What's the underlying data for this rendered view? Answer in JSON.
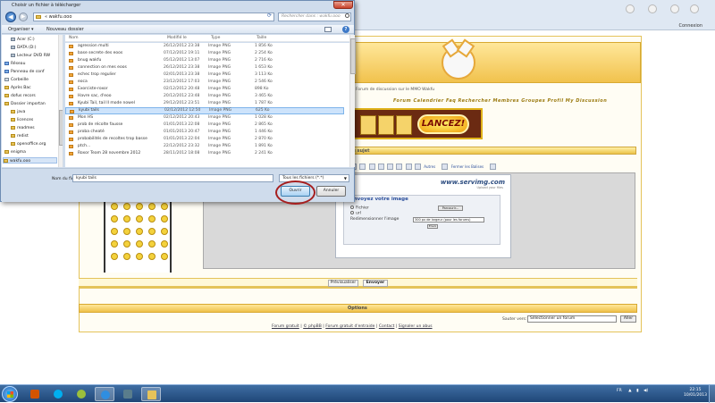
{
  "browser": {
    "login_label": "Connexion"
  },
  "forum": {
    "tagline": "Forum de discussion sur le MMO Wakfu",
    "nav": "Forum  Calendrier  Faq  Rechercher  Membres  Groupes  Profil  My  Discussion",
    "ad_button": "LANCEZ!",
    "post_header": "Nouveau sujet",
    "toolbar_texts": [
      "Autres",
      "Fermer les Balises"
    ],
    "upload": {
      "logo": "www.servimg.com",
      "slogan": "Upload your files",
      "title": "Envoyez votre image",
      "file_label": "Fichier",
      "url_label": "url",
      "browse_label": "Parcourir...",
      "resize_label": "Redimensionner l'image",
      "resize_value": "300 px de largeur (pour les forums)",
      "send_label": "Envoi"
    },
    "preview_label": "Prévisualiser",
    "send_label": "Envoyer",
    "options_label": "Options",
    "jump_label": "Sauter vers:",
    "jump_value": "Sélectionner un forum",
    "go_label": "Aller",
    "footer_links": [
      "Forum gratuit",
      "© phpBB",
      "Forum gratuit d'entraide",
      "Contact",
      "Signaler un abus"
    ]
  },
  "dialog": {
    "title": "Choisir un fichier à télécharger",
    "address": "« wakfu.ooo",
    "search_placeholder": "Rechercher dans : wakfu.ooo",
    "organiser_label": "Organiser ▾",
    "new_folder_label": "Nouveau dossier",
    "nav_items": [
      "Acer (C:)",
      "DATA (D:)",
      "Lecteur DVD RW",
      "Réseau",
      "Panneau de conf",
      "Corbeille",
      "Après Bac",
      "dofus recors",
      "Dossier importan",
      "java",
      "licences",
      "readmes",
      "redist",
      "openoffice.org",
      "enigma",
      "wakfu.ooo"
    ],
    "columns": {
      "name": "Nom",
      "date": "Modifié le",
      "type": "Type",
      "size": "Taille"
    },
    "files": [
      {
        "name": "agression multi",
        "date": "26/12/2012 23:38",
        "type": "Image PNG",
        "size": "1 856 Ko"
      },
      {
        "name": "base secrete des eoos",
        "date": "07/12/2012 19:11",
        "type": "Image PNG",
        "size": "2 254 Ko"
      },
      {
        "name": "bnug wakfu",
        "date": "05/12/2012 13:07",
        "type": "Image PNG",
        "size": "2 716 Ko"
      },
      {
        "name": "connection on mes eoos",
        "date": "26/12/2012 23:38",
        "type": "Image PNG",
        "size": "1 653 Ko"
      },
      {
        "name": "echec trop regulier",
        "date": "02/01/2013 23:38",
        "type": "Image PNG",
        "size": "3 113 Ko"
      },
      {
        "name": "eoca",
        "date": "23/12/2012 17:03",
        "type": "Image PNG",
        "size": "2 546 Ko"
      },
      {
        "name": "Exorciste-roxor",
        "date": "02/12/2012 20:48",
        "type": "Image PNG",
        "size": "898 Ko"
      },
      {
        "name": "Havre sac, d'eoo",
        "date": "20/12/2012 23:48",
        "type": "Image PNG",
        "size": "3 465 Ko"
      },
      {
        "name": "Kyubi Tail, tail II mode nowel",
        "date": "29/12/2012 23:51",
        "type": "Image PNG",
        "size": "1 787 Ko"
      },
      {
        "name": "kyubi tails",
        "date": "02/12/2012 12:50",
        "type": "Image PNG",
        "size": "625 Ko"
      },
      {
        "name": "Mon HS",
        "date": "02/12/2012 20:43",
        "type": "Image PNG",
        "size": "1 028 Ko"
      },
      {
        "name": "prob de récolte fausse",
        "date": "01/01/2013 22:08",
        "type": "Image PNG",
        "size": "2 865 Ko"
      },
      {
        "name": "proba cheaté",
        "date": "01/01/2013 20:47",
        "type": "Image PNG",
        "size": "1 446 Ko"
      },
      {
        "name": "probabilités de recoltes trop basse",
        "date": "01/01/2013 22:04",
        "type": "Image PNG",
        "size": "2 870 Ko"
      },
      {
        "name": "ptch...",
        "date": "22/12/2012 23:32",
        "type": "Image PNG",
        "size": "1 891 Ko"
      },
      {
        "name": "Roxor Team 28 novembre 2012",
        "date": "28/11/2012 18:08",
        "type": "Image PNG",
        "size": "2 241 Ko"
      }
    ],
    "filename_label": "Nom du fichier :",
    "filename_value": "kyubi tails",
    "filetype_value": "Tous les fichiers (*.*)",
    "open_label": "Ouvrir",
    "cancel_label": "Annuler"
  },
  "taskbar": {
    "lang": "FR",
    "time": "22:15",
    "date": "10/01/2013"
  },
  "colors": {
    "accent": "#2b4f9c",
    "forum_gold": "#e4c35a",
    "highlight_circle": "#a61f1f"
  }
}
